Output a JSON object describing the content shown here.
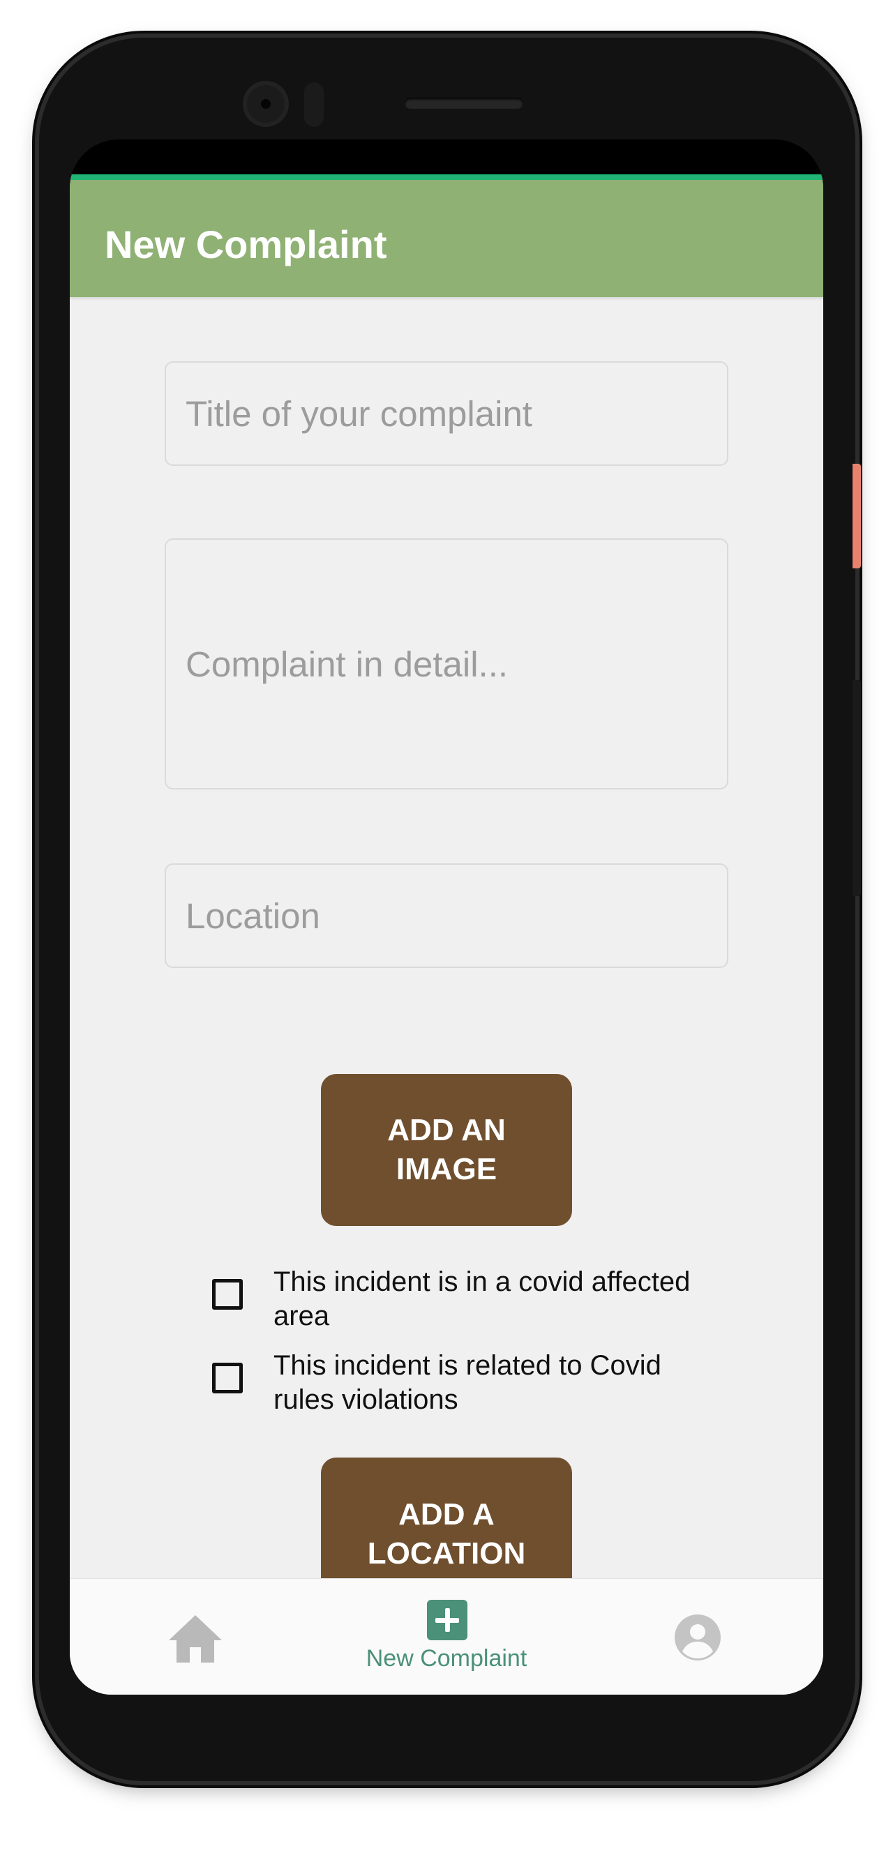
{
  "header": {
    "title": "New Complaint"
  },
  "form": {
    "title_placeholder": "Title of your complaint",
    "detail_placeholder": "Complaint in detail...",
    "location_placeholder": "Location",
    "add_image_label": "ADD AN IMAGE",
    "checkbox_covid_area": {
      "label": "This incident is in a covid affected area",
      "checked": false
    },
    "checkbox_covid_rules": {
      "label": "This incident is related to Covid rules violations",
      "checked": false
    },
    "add_location_label": "ADD A LOCATION"
  },
  "bottom_nav": {
    "items": [
      {
        "icon": "home-icon",
        "label": ""
      },
      {
        "icon": "plus-square-icon",
        "label": "New Complaint",
        "active": true
      },
      {
        "icon": "account-circle-icon",
        "label": ""
      }
    ]
  },
  "colors": {
    "header_bg": "#8fb174",
    "header_accent": "#1fb574",
    "button_bg": "#704f2e",
    "active_nav": "#4b9078",
    "side_button": "#e8826e"
  }
}
